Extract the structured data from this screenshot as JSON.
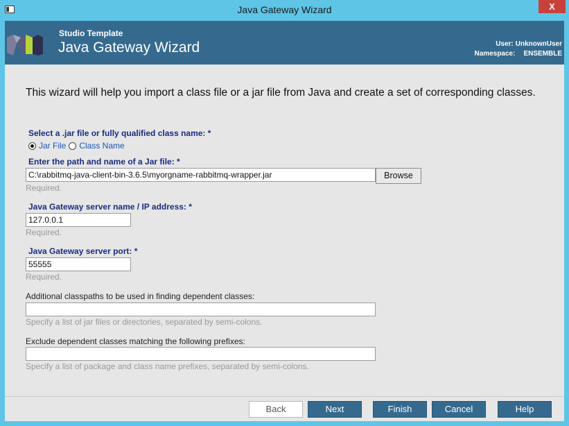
{
  "window": {
    "title": "Java Gateway Wizard",
    "close_glyph": "X"
  },
  "header": {
    "subtitle": "Studio Template",
    "title": "Java Gateway Wizard",
    "user_label": "User:",
    "user_value": "UnknownUser",
    "namespace_label": "Namespace:",
    "namespace_value": "ENSEMBLE"
  },
  "intro": "This wizard will help you import a class file or a jar file from Java and create a set of corresponding classes.",
  "select": {
    "label": "Select a .jar file or fully qualified class name: *",
    "options": [
      {
        "label": "Jar File",
        "selected": true
      },
      {
        "label": "Class Name",
        "selected": false
      }
    ]
  },
  "jar": {
    "label": "Enter the path and name of a Jar file: *",
    "value": "C:\\rabbitmq-java-client-bin-3.6.5\\myorgname-rabbitmq-wrapper.jar",
    "hint": "Required.",
    "browse_label": "Browse"
  },
  "server": {
    "label": "Java Gateway server name / IP address: *",
    "value": "127.0.0.1",
    "hint": "Required."
  },
  "port": {
    "label": "Java Gateway server port: *",
    "value": "55555",
    "hint": "Required."
  },
  "classpaths": {
    "label": "Additional classpaths to be used in finding dependent classes:",
    "value": "",
    "hint": "Specify a list of jar files or directories, separated by semi-colons."
  },
  "exclude": {
    "label": "Exclude dependent classes matching the following prefixes:",
    "value": "",
    "hint": "Specify a list of package and class name prefixes, separated by semi-colons."
  },
  "buttons": {
    "back": "Back",
    "next": "Next",
    "finish": "Finish",
    "cancel": "Cancel",
    "help": "Help"
  },
  "colors": {
    "header": "#356a8e",
    "titlebar": "#5fc5e6",
    "label": "#1b2b80",
    "close": "#c7403b"
  },
  "icons": {
    "system_menu": "window-icon",
    "logo": "studio-logo-icon"
  }
}
